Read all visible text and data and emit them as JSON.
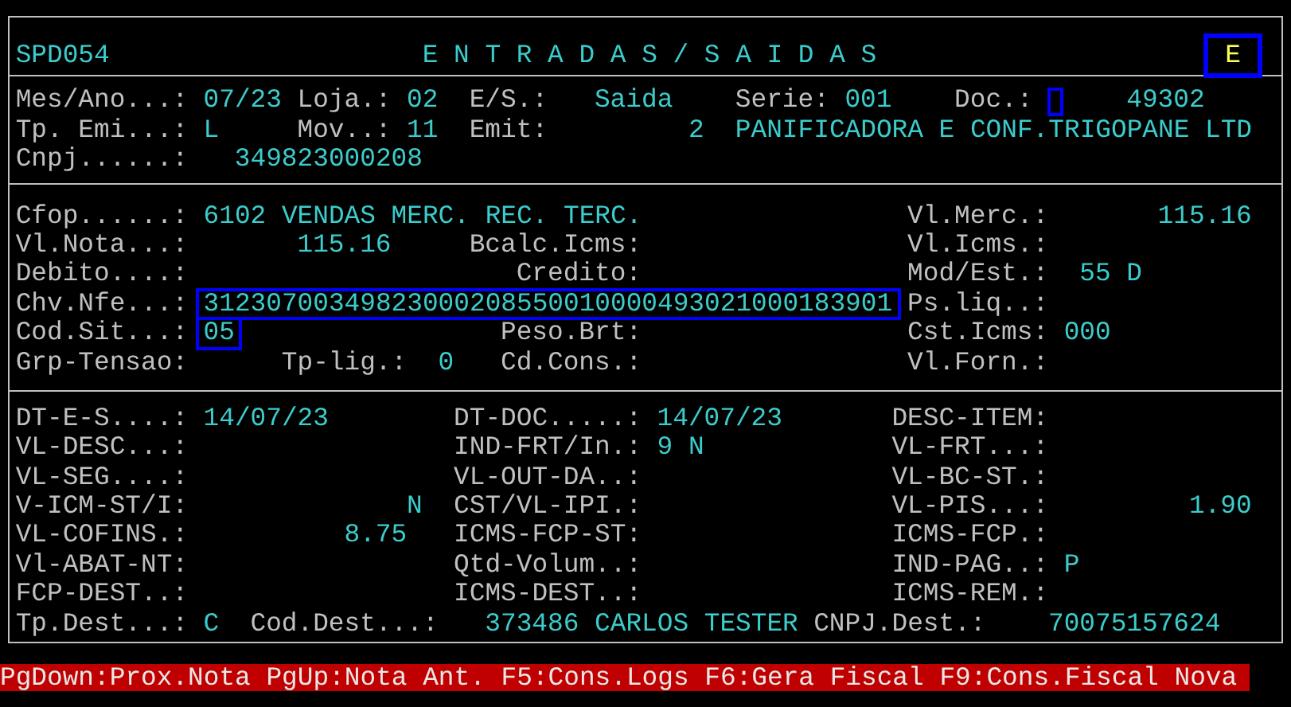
{
  "header": {
    "program": "SPD054",
    "title": "E N T R A D A S / S A I D A S",
    "mode": {
      "text": "E",
      "highlighted": true
    }
  },
  "sections": [
    {
      "lines": [
        [
          {
            "label": "Mes/Ano...:",
            "value": "07/23",
            "highlighted": false,
            "cursor": false
          },
          {
            "label": "Loja.:",
            "value": "02",
            "highlighted": false,
            "cursor": false
          },
          {
            "label": "E/S.:",
            "value": "Saida",
            "highlighted": false,
            "cursor": false
          },
          {
            "label": "Serie:",
            "value": "001",
            "highlighted": false,
            "cursor": false
          },
          {
            "label": "Doc.:",
            "value": "49302",
            "highlighted": false,
            "cursor": true
          }
        ],
        [
          {
            "label": "Tp. Emi...:",
            "value": "L",
            "highlighted": false,
            "cursor": false
          },
          {
            "label": "Mov..:",
            "value": "11",
            "highlighted": false,
            "cursor": false
          },
          {
            "label": "Emit:",
            "value": "2",
            "highlighted": false,
            "cursor": false
          },
          {
            "value": "PANIFICADORA E CONF.TRIGOPANE LTD",
            "highlighted": false,
            "cursor": false
          }
        ],
        [
          {
            "label": "Cnpj......:",
            "value": "349823000208",
            "highlighted": false,
            "cursor": false
          }
        ]
      ]
    },
    {
      "lines": [
        [
          {
            "label": "Cfop......:",
            "value": "6102 VENDAS MERC. REC. TERC.",
            "highlighted": false,
            "cursor": false
          },
          {
            "label": "Vl.Merc.:",
            "value": "115.16",
            "highlighted": false,
            "cursor": false
          }
        ],
        [
          {
            "label": "Vl.Nota...:",
            "value": "115.16",
            "highlighted": false,
            "cursor": false
          },
          {
            "label": "Bcalc.Icms:",
            "highlighted": false,
            "cursor": false
          },
          {
            "label": "Vl.Icms.:",
            "highlighted": false,
            "cursor": false
          }
        ],
        [
          {
            "label": "Debito....:",
            "highlighted": false,
            "cursor": false
          },
          {
            "label": "Credito:",
            "highlighted": false,
            "cursor": false
          },
          {
            "label": "Mod/Est.:",
            "value": "55 D",
            "highlighted": false,
            "cursor": false
          }
        ],
        [
          {
            "label": "Chv.Nfe...:",
            "value": "31230700349823000208550010000493021000183901",
            "highlighted": true,
            "cursor": false
          },
          {
            "label": "Ps.liq..:",
            "highlighted": false,
            "cursor": false
          }
        ],
        [
          {
            "label": "Cod.Sit...:",
            "value": "05",
            "highlighted": true,
            "cursor": false
          },
          {
            "label": "Peso.Brt:",
            "highlighted": false,
            "cursor": false
          },
          {
            "label": "Cst.Icms:",
            "value": "000",
            "highlighted": false,
            "cursor": false
          }
        ],
        [
          {
            "label": "Grp-Tensao:",
            "highlighted": false,
            "cursor": false
          },
          {
            "label": "Tp-lig.:",
            "value": "0",
            "highlighted": false,
            "cursor": false
          },
          {
            "label": "Cd.Cons.:",
            "highlighted": false,
            "cursor": false
          },
          {
            "label": "Vl.Forn.:",
            "highlighted": false,
            "cursor": false
          }
        ]
      ]
    },
    {
      "lines": [
        [
          {
            "label": "DT-E-S....:",
            "value": "14/07/23",
            "highlighted": false,
            "cursor": false
          },
          {
            "label": "DT-DOC.....:",
            "value": "14/07/23",
            "highlighted": false,
            "cursor": false
          },
          {
            "label": "DESC-ITEM:",
            "highlighted": false,
            "cursor": false
          }
        ],
        [
          {
            "label": "VL-DESC...:",
            "highlighted": false,
            "cursor": false
          },
          {
            "label": "IND-FRT/In.:",
            "value": "9 N",
            "highlighted": false,
            "cursor": false
          },
          {
            "label": "VL-FRT...:",
            "highlighted": false,
            "cursor": false
          }
        ],
        [
          {
            "label": "VL-SEG....:",
            "highlighted": false,
            "cursor": false
          },
          {
            "label": "VL-OUT-DA..:",
            "highlighted": false,
            "cursor": false
          },
          {
            "label": "VL-BC-ST.:",
            "highlighted": false,
            "cursor": false
          }
        ],
        [
          {
            "label": "V-ICM-ST/I:",
            "value": "N",
            "highlighted": false,
            "cursor": false
          },
          {
            "label": "CST/VL-IPI.:",
            "highlighted": false,
            "cursor": false
          },
          {
            "label": "VL-PIS...:",
            "value": "1.90",
            "highlighted": false,
            "cursor": false
          }
        ],
        [
          {
            "label": "VL-COFINS.:",
            "value": "8.75",
            "highlighted": false,
            "cursor": false
          },
          {
            "label": "ICMS-FCP-ST:",
            "highlighted": false,
            "cursor": false
          },
          {
            "label": "ICMS-FCP.:",
            "highlighted": false,
            "cursor": false
          }
        ],
        [
          {
            "label": "Vl-ABAT-NT:",
            "highlighted": false,
            "cursor": false
          },
          {
            "label": "Qtd-Volum..:",
            "highlighted": false,
            "cursor": false
          },
          {
            "label": "IND-PAG..:",
            "value": "P",
            "highlighted": false,
            "cursor": false
          }
        ],
        [
          {
            "label": "FCP-DEST..:",
            "highlighted": false,
            "cursor": false
          },
          {
            "label": "ICMS-DEST..:",
            "highlighted": false,
            "cursor": false
          },
          {
            "label": "ICMS-REM.:",
            "highlighted": false,
            "cursor": false
          }
        ],
        [
          {
            "label": "Tp.Dest...:",
            "value": "C",
            "highlighted": false,
            "cursor": false
          },
          {
            "label": "Cod.Dest...:",
            "value": "373486 CARLOS TESTER",
            "highlighted": false,
            "cursor": false
          },
          {
            "label": "CNPJ.Dest.:",
            "value": "70075157624",
            "highlighted": false,
            "cursor": false
          }
        ]
      ]
    }
  ],
  "status_bar": [
    "PgDown:Prox.Nota",
    "PgUp:Nota Ant.",
    "F5:Cons.Logs",
    "F6:Gera Fiscal",
    "F9:Cons.Fiscal Nova"
  ]
}
